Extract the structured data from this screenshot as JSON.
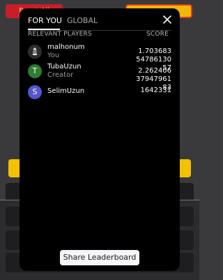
{
  "tabs": [
    {
      "label": "FOR YOU",
      "active": true
    },
    {
      "label": "GLOBAL",
      "active": false
    }
  ],
  "close_icon": "close-icon",
  "columns": {
    "left": "RELEVANT PLAYERS",
    "right": "SCORE"
  },
  "players": [
    {
      "name": "malhonum",
      "role": "You",
      "avatar": "zebra-icon",
      "score": "1.7036835478613057"
    },
    {
      "name": "TubaUzun",
      "role": "Creator",
      "avatar": "T",
      "score": "2.2624063794796183"
    },
    {
      "name": "SelimUzun",
      "role": "",
      "avatar": "S",
      "score": "1642331"
    }
  ],
  "share_button": "Share Leaderboard",
  "background": {
    "top_left_button": "Reset All"
  },
  "colors": {
    "modal_bg": "#000000",
    "avatar_green": "#2f7d33",
    "avatar_purple": "#5558c9",
    "button_bg": "#f5f5f7",
    "bg_yellow": "#f2c200",
    "bg_red": "#c81e2a"
  }
}
